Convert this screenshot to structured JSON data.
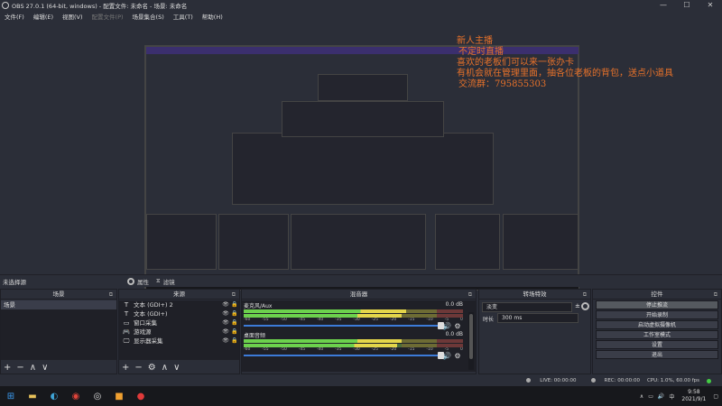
{
  "window": {
    "title": "OBS 27.0.1 (64-bit, windows) - 配置文件: 未命名 - 场景: 未命名",
    "minimize": "—",
    "maximize": "☐",
    "close": "✕"
  },
  "menu": [
    {
      "label": "文件(F)",
      "disabled": false
    },
    {
      "label": "编辑(E)",
      "disabled": false
    },
    {
      "label": "视图(V)",
      "disabled": false
    },
    {
      "label": "配置文件(P)",
      "disabled": true
    },
    {
      "label": "场景集合(S)",
      "disabled": false
    },
    {
      "label": "工具(T)",
      "disabled": false
    },
    {
      "label": "帮助(H)",
      "disabled": false
    }
  ],
  "overlay": {
    "line1": "新人主播",
    "line2": "不定时直播",
    "line3": "喜欢的老板们可以来一张办卡",
    "line4": "有机会就在管理里面，抽各位老板的背包，送点小道具",
    "line5": "交流群：795855303"
  },
  "source_bar": {
    "no_source": "未选择源",
    "properties": "属性",
    "filters": "滤镜"
  },
  "docks": {
    "scenes": {
      "title": "场景",
      "items": [
        "场景"
      ]
    },
    "sources": {
      "title": "来源",
      "items": [
        {
          "icon": "text-icon",
          "glyph": "T",
          "label": "文本 (GDI+) 2"
        },
        {
          "icon": "text-icon",
          "glyph": "T",
          "label": "文本 (GDI+)"
        },
        {
          "icon": "window-icon",
          "glyph": "▭",
          "label": "窗口采集"
        },
        {
          "icon": "game-icon",
          "glyph": "🎮",
          "label": "游戏源"
        },
        {
          "icon": "monitor-icon",
          "glyph": "🖵",
          "label": "显示器采集"
        }
      ]
    },
    "mixer": {
      "title": "混音器",
      "tracks": [
        {
          "name": "麦克风/Aux",
          "db": "0.0 dB",
          "level": 0.74
        },
        {
          "name": "桌面音频",
          "db": "0.0 dB",
          "level": 0.72
        }
      ],
      "ticks": [
        "-60",
        "-55",
        "-50",
        "-45",
        "-40",
        "-35",
        "-30",
        "-25",
        "-20",
        "-15",
        "-10",
        "-5",
        "0"
      ]
    },
    "transitions": {
      "title": "转场特效",
      "selected": "淡变",
      "duration_label": "时长",
      "duration_value": "300 ms"
    },
    "controls": {
      "title": "控件",
      "buttons": [
        "停止推流",
        "开始录制",
        "启动虚拟摄像机",
        "工作室模式",
        "设置",
        "退出"
      ]
    }
  },
  "status": {
    "live": "LIVE: 00:00:00",
    "rec": "REC: 00:00:00",
    "cpu": "CPU: 1.0%, 60.00 fps"
  },
  "taskbar": {
    "time": "9:58",
    "date": "2021/9/1",
    "lang": "中"
  },
  "colors": {
    "overlay_text": "#e8722a",
    "meter_green": "#6cd14d",
    "meter_yellow": "#e3d54a",
    "volume_blue": "#3c7bd8"
  }
}
